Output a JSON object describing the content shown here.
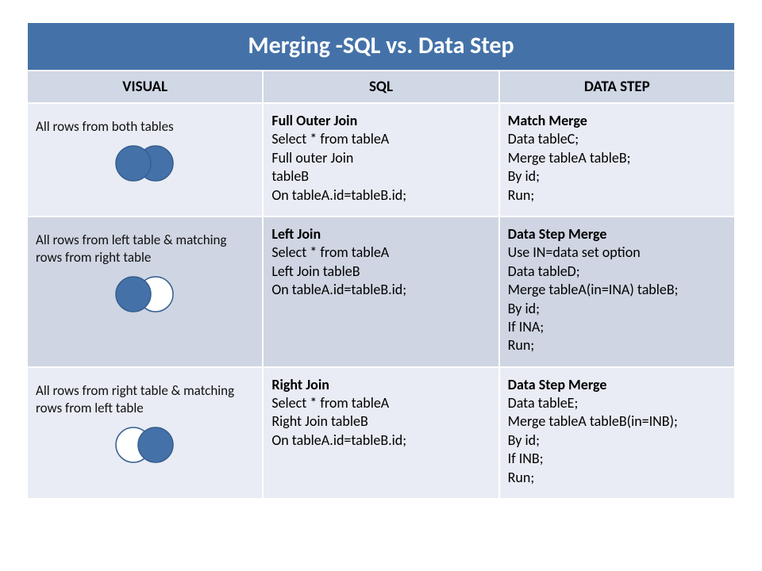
{
  "title": "Merging -SQL vs. Data Step",
  "columns": {
    "visual": "VISUAL",
    "sql": "SQL",
    "datastep": "DATA STEP"
  },
  "colors": {
    "fill": "#4472a8",
    "stroke": "#365f8f"
  },
  "rows": [
    {
      "visual_caption": "All rows from both tables",
      "venn": "full",
      "sql_title": "Full Outer Join",
      "sql_lines": [
        "Select * from tableA",
        "Full outer Join",
        "tableB",
        "On tableA.id=tableB.id;"
      ],
      "ds_title": "Match Merge",
      "ds_lines": [
        "Data tableC;",
        "Merge tableA tableB;",
        "By id;",
        "Run;"
      ]
    },
    {
      "visual_caption": "All rows from left table & matching rows from right table",
      "venn": "left",
      "sql_title": "Left Join",
      "sql_lines": [
        "Select * from tableA",
        "Left Join tableB",
        "On tableA.id=tableB.id;"
      ],
      "ds_title": "Data Step Merge",
      "ds_lines": [
        "Use IN=data set option",
        "Data tableD;",
        "Merge tableA(in=INA) tableB;",
        "By id;",
        "If INA;",
        "Run;"
      ]
    },
    {
      "visual_caption": "All rows from right table & matching rows from left table",
      "venn": "right",
      "sql_title": "Right Join",
      "sql_lines": [
        "Select * from tableA",
        "Right Join tableB",
        "On tableA.id=tableB.id;"
      ],
      "ds_title": "Data Step Merge",
      "ds_lines": [
        "Data tableE;",
        "Merge tableA tableB(in=INB);",
        "By id;",
        "If INB;",
        "Run;"
      ]
    }
  ]
}
